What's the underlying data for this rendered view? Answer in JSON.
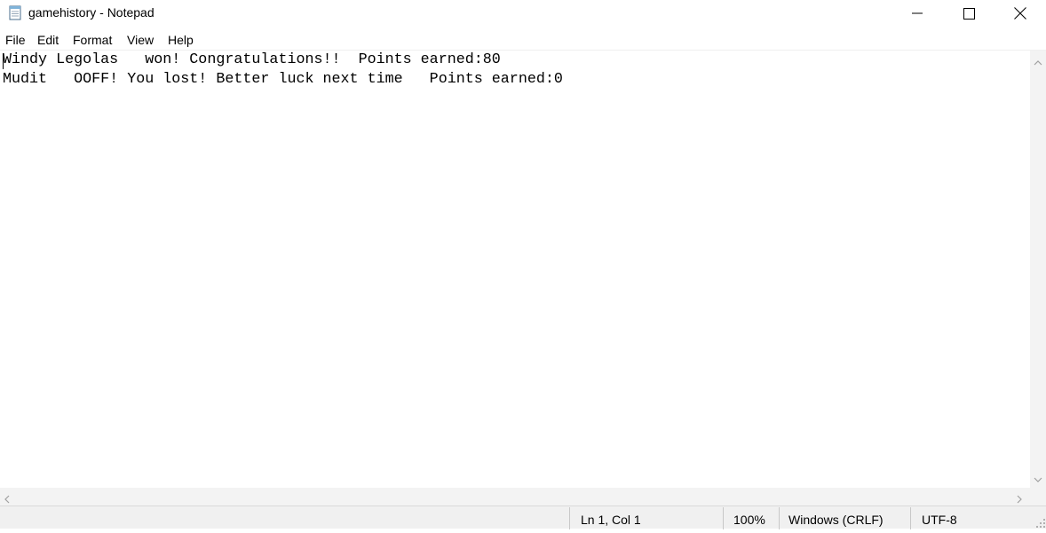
{
  "window": {
    "title": "gamehistory - Notepad",
    "app_icon": "notepad-icon",
    "controls": [
      "minimize-icon",
      "maximize-icon",
      "close-icon"
    ]
  },
  "menu": {
    "items": [
      {
        "label": "File"
      },
      {
        "label": "Edit"
      },
      {
        "label": "Format"
      },
      {
        "label": "View"
      },
      {
        "label": "Help"
      }
    ]
  },
  "editor": {
    "lines": [
      "Windy Legolas   won! Congratulations!!  Points earned:80",
      "Mudit   OOFF! You lost! Better luck next time   Points earned:0"
    ]
  },
  "status": {
    "position": "Ln 1, Col 1",
    "zoom": "100%",
    "line_ending": "Windows (CRLF)",
    "encoding": "UTF-8"
  }
}
